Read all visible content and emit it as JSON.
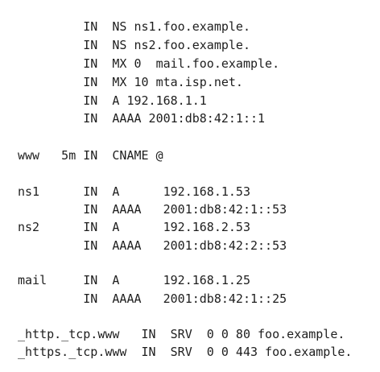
{
  "zone_file": {
    "lines": [
      "         IN  NS ns1.foo.example.",
      "         IN  NS ns2.foo.example.",
      "         IN  MX 0  mail.foo.example.",
      "         IN  MX 10 mta.isp.net.",
      "         IN  A 192.168.1.1",
      "         IN  AAAA 2001:db8:42:1::1",
      "www   5m IN  CNAME @",
      "ns1      IN  A      192.168.1.53",
      "         IN  AAAA   2001:db8:42:1::53",
      "ns2      IN  A      192.168.2.53",
      "         IN  AAAA   2001:db8:42:2::53",
      "mail     IN  A      192.168.1.25",
      "         IN  AAAA   2001:db8:42:1::25",
      "_http._tcp.www   IN  SRV  0 0 80 foo.example.",
      "_https._tcp.www  IN  SRV  0 0 443 foo.example."
    ]
  }
}
